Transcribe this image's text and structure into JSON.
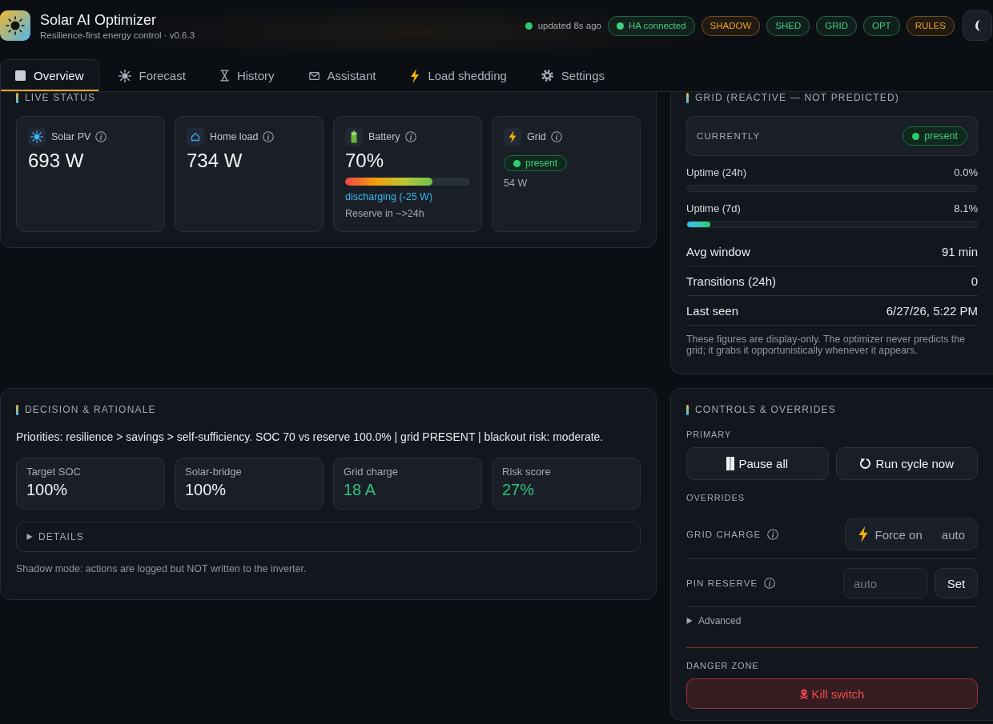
{
  "app": {
    "title": "Solar AI Optimizer",
    "subtitle": "Resilience-first energy control · v0.6.3"
  },
  "status": {
    "text": "updated 8s ago"
  },
  "pills": [
    {
      "label": "HA connected",
      "color": "#3fcf80",
      "dot": true
    },
    {
      "label": "SHADOW",
      "color": "#f0a020",
      "dot": false
    },
    {
      "label": "SHED",
      "color": "#3fcf80",
      "dot": false
    },
    {
      "label": "GRID",
      "color": "#3fcf80",
      "dot": false
    },
    {
      "label": "OPT",
      "color": "#3fcf80",
      "dot": false
    },
    {
      "label": "RULES",
      "color": "#f0a020",
      "dot": false
    }
  ],
  "tabs": [
    {
      "label": "Overview",
      "selected": true
    },
    {
      "label": "Forecast",
      "selected": false
    },
    {
      "label": "History",
      "selected": false
    },
    {
      "label": "Assistant",
      "selected": false
    },
    {
      "label": "Load shedding",
      "selected": false
    },
    {
      "label": "Settings",
      "selected": false
    }
  ],
  "live_status": {
    "title": "LIVE STATUS",
    "tiles": [
      {
        "kind": "solar",
        "label": "Solar PV",
        "value": "693 W"
      },
      {
        "kind": "load",
        "label": "Home load",
        "value": "734 W"
      },
      {
        "kind": "battery",
        "label": "Battery",
        "value": "70%",
        "level": 0.7,
        "status": "discharging (-25 W)",
        "reserve": "Reserve in ~>24h"
      },
      {
        "kind": "grid",
        "label": "Grid",
        "state": "present",
        "reading": "54 W"
      }
    ]
  },
  "grid_panel": {
    "title": "GRID (REACTIVE — NOT PREDICTED)",
    "currently": {
      "label": "CURRENTLY",
      "state": "present"
    },
    "uptimes": [
      {
        "label": "Uptime (24h)",
        "value": "0.0%"
      },
      {
        "label": "Uptime (7d)",
        "value": "8.1%",
        "level": 0.081
      }
    ],
    "rows": [
      {
        "label": "Avg window",
        "value": "91 min"
      },
      {
        "label": "Transitions (24h)",
        "value": "0"
      },
      {
        "label": "Last seen",
        "value": "6/27/26, 5:22 PM"
      }
    ],
    "note": "These figures are display-only. The optimizer never predicts the grid; it grabs it opportunistically whenever it appears."
  },
  "decision": {
    "title": "DECISION & RATIONALE",
    "summary": "Priorities: resilience > savings > self-sufficiency. SOC 70 vs reserve 100.0% | grid PRESENT | blackout risk: moderate.",
    "metrics": [
      {
        "label": "Target SOC",
        "value": "100%",
        "color": "#eef0f2"
      },
      {
        "label": "Solar-bridge",
        "value": "100%",
        "color": "#eef0f2"
      },
      {
        "label": "Grid charge",
        "value": "18 A",
        "color": "#2ec27e"
      },
      {
        "label": "Risk score",
        "value": "27%",
        "color": "#2ec27e"
      }
    ],
    "details": {
      "label": "DETAILS",
      "expanded": false
    },
    "note": "Shadow mode: actions are logged but NOT written to the inverter."
  },
  "controls": {
    "title": "CONTROLS & OVERRIDES",
    "primary_label": "PRIMARY",
    "primary_buttons": [
      "Pause all",
      "Run cycle now"
    ],
    "overrides_label": "OVERRIDES",
    "grid_charge": {
      "label": "GRID CHARGE",
      "options": [
        {
          "label": "Force on",
          "selected": false
        },
        {
          "label": "auto",
          "selected": false
        }
      ]
    },
    "pin_reserve": {
      "label": "PIN RESERVE",
      "placeholder": "auto",
      "button": "Set"
    },
    "advanced": {
      "label": "Advanced",
      "expanded": false
    },
    "danger_label": "DANGER ZONE",
    "kill_button": "Kill switch"
  }
}
